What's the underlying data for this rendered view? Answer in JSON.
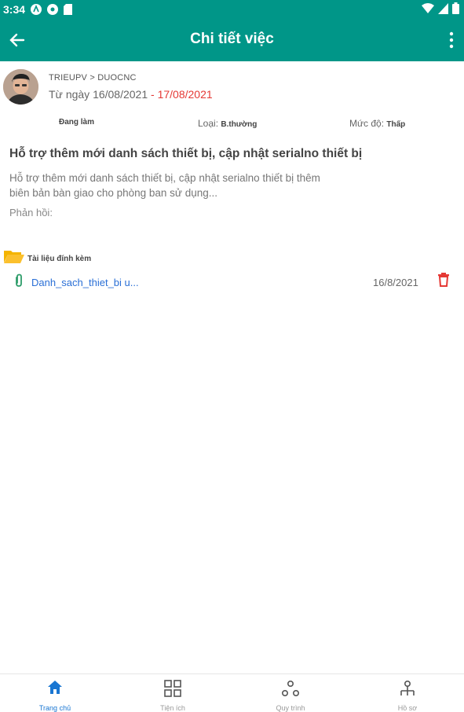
{
  "status_bar": {
    "time": "3:34"
  },
  "app_bar": {
    "title": "Chi tiết việc"
  },
  "task": {
    "path": "TRIEUPV > DUOCNC",
    "date_from_label": "Từ ngày ",
    "date_from": "16/08/2021",
    "date_sep": " - ",
    "date_to": "17/08/2021",
    "status": "Đang làm",
    "type_label": "Loại: ",
    "type_value": "B.thường",
    "level_label": "Mức độ: ",
    "level_value": "Thấp",
    "title": "Hỗ trợ thêm mới danh sách thiết bị, cập nhật serialno thiết bị",
    "description": "Hỗ trợ thêm mới danh sách thiết bị, cập nhật serialno thiết bị thêm biên bản bàn giao cho phòng ban sử dụng...",
    "feedback_label": "Phản hồi:"
  },
  "attachments": {
    "title": "Tài liệu đính kèm",
    "items": [
      {
        "name": "Danh_sach_thiet_bi u...",
        "date": "16/8/2021"
      }
    ]
  },
  "colors": {
    "primary": "#009688",
    "accent_red": "#e53935",
    "link": "#2a6fd6",
    "nav_active": "#1976d2"
  },
  "bottom_nav": [
    {
      "label": "Trang chủ",
      "icon": "home-icon"
    },
    {
      "label": "Tiện ích",
      "icon": "grid-icon"
    },
    {
      "label": "Quy trình",
      "icon": "workflow-icon"
    },
    {
      "label": "Hồ sơ",
      "icon": "profile-icon"
    }
  ]
}
